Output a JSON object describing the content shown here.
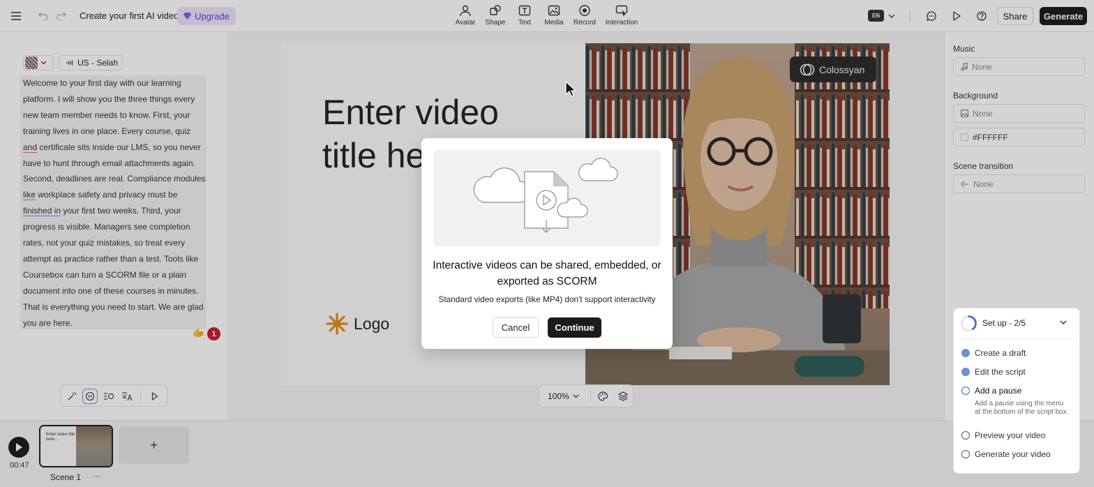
{
  "topbar": {
    "doc_title": "Create your first AI video",
    "upgrade_label": "Upgrade",
    "tools": [
      {
        "label": "Avatar",
        "icon": "avatar-icon"
      },
      {
        "label": "Shape",
        "icon": "shape-icon"
      },
      {
        "label": "Text",
        "icon": "text-icon"
      },
      {
        "label": "Media",
        "icon": "media-icon"
      },
      {
        "label": "Record",
        "icon": "record-icon"
      },
      {
        "label": "Interaction",
        "icon": "interaction-icon"
      }
    ],
    "language": "EN",
    "share_label": "Share",
    "generate_label": "Generate"
  },
  "script_panel": {
    "voice": "US - Selah",
    "notification_count": "1",
    "text": {
      "p1": "Welcome to your first day with our learning platform. I will show you the three things every new team member needs to know. First, your training lives in one place. Every course, quiz ",
      "w_and": "and",
      "p2": " certificate sits inside our LMS, so you never have to hunt through email attachments again. Second, deadlines are real. Compliance modules ",
      "w_like": "like",
      "p3": " workplace safety and privacy must be ",
      "w_finished": "finished in",
      "p4": " your first two weeks. Third, your progress is visible. Managers see completion rates, not your quiz mistakes, so treat every attempt as practice rather than a test. Tools like Coursebox can turn a SCORM file or a plain document into one of these courses in minutes. That is everything you need to start. We are glad you are here."
    }
  },
  "slide": {
    "title": "Enter video\ntitle here...",
    "logo_text": "Logo",
    "brand_badge": "Colossyan"
  },
  "zoom": {
    "level": "100%"
  },
  "right_panel": {
    "music_label": "Music",
    "music_value": "None",
    "background_label": "Background",
    "background_value": "None",
    "background_color": "#FFFFFF",
    "transition_label": "Scene transition",
    "transition_value": "None"
  },
  "setup": {
    "title": "Set up - 2/5",
    "progress": 0.4,
    "items": [
      {
        "label": "Create a draft",
        "state": "done"
      },
      {
        "label": "Edit the script",
        "state": "done"
      },
      {
        "label": "Add a pause",
        "state": "active",
        "description": "Add a pause using the menu at the bottom of the script box."
      },
      {
        "label": "Preview your video",
        "state": "open"
      },
      {
        "label": "Generate your video",
        "state": "open"
      }
    ]
  },
  "timeline": {
    "duration": "00:47",
    "scene_name": "Scene 1",
    "thumb_title": "Enter video title here...",
    "scene_menu": "···",
    "add_label": "+"
  },
  "modal": {
    "title": "Interactive videos can be shared, embedded, or exported as SCORM",
    "subtitle": "Standard video exports (like MP4) don't support interactivity",
    "cancel_label": "Cancel",
    "continue_label": "Continue"
  },
  "colors": {
    "accent": "#6b3fd4",
    "primary_button": "#1b1b1b",
    "badge": "#c81d2f"
  }
}
